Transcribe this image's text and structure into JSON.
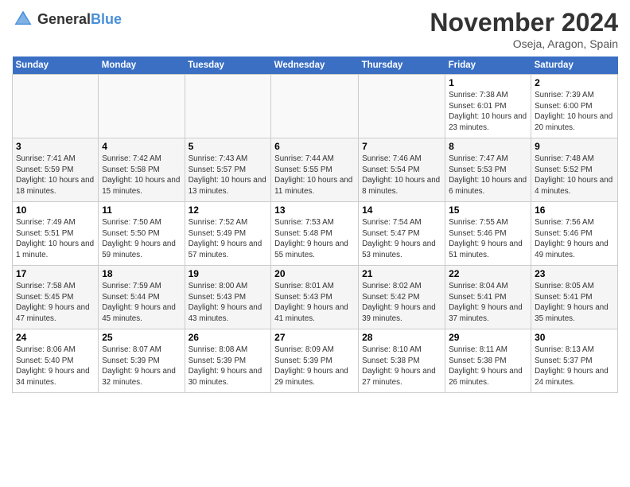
{
  "logo": {
    "general": "General",
    "blue": "Blue"
  },
  "title": "November 2024",
  "subtitle": "Oseja, Aragon, Spain",
  "days_of_week": [
    "Sunday",
    "Monday",
    "Tuesday",
    "Wednesday",
    "Thursday",
    "Friday",
    "Saturday"
  ],
  "weeks": [
    [
      {
        "day": "",
        "info": ""
      },
      {
        "day": "",
        "info": ""
      },
      {
        "day": "",
        "info": ""
      },
      {
        "day": "",
        "info": ""
      },
      {
        "day": "",
        "info": ""
      },
      {
        "day": "1",
        "info": "Sunrise: 7:38 AM\nSunset: 6:01 PM\nDaylight: 10 hours and 23 minutes."
      },
      {
        "day": "2",
        "info": "Sunrise: 7:39 AM\nSunset: 6:00 PM\nDaylight: 10 hours and 20 minutes."
      }
    ],
    [
      {
        "day": "3",
        "info": "Sunrise: 7:41 AM\nSunset: 5:59 PM\nDaylight: 10 hours and 18 minutes."
      },
      {
        "day": "4",
        "info": "Sunrise: 7:42 AM\nSunset: 5:58 PM\nDaylight: 10 hours and 15 minutes."
      },
      {
        "day": "5",
        "info": "Sunrise: 7:43 AM\nSunset: 5:57 PM\nDaylight: 10 hours and 13 minutes."
      },
      {
        "day": "6",
        "info": "Sunrise: 7:44 AM\nSunset: 5:55 PM\nDaylight: 10 hours and 11 minutes."
      },
      {
        "day": "7",
        "info": "Sunrise: 7:46 AM\nSunset: 5:54 PM\nDaylight: 10 hours and 8 minutes."
      },
      {
        "day": "8",
        "info": "Sunrise: 7:47 AM\nSunset: 5:53 PM\nDaylight: 10 hours and 6 minutes."
      },
      {
        "day": "9",
        "info": "Sunrise: 7:48 AM\nSunset: 5:52 PM\nDaylight: 10 hours and 4 minutes."
      }
    ],
    [
      {
        "day": "10",
        "info": "Sunrise: 7:49 AM\nSunset: 5:51 PM\nDaylight: 10 hours and 1 minute."
      },
      {
        "day": "11",
        "info": "Sunrise: 7:50 AM\nSunset: 5:50 PM\nDaylight: 9 hours and 59 minutes."
      },
      {
        "day": "12",
        "info": "Sunrise: 7:52 AM\nSunset: 5:49 PM\nDaylight: 9 hours and 57 minutes."
      },
      {
        "day": "13",
        "info": "Sunrise: 7:53 AM\nSunset: 5:48 PM\nDaylight: 9 hours and 55 minutes."
      },
      {
        "day": "14",
        "info": "Sunrise: 7:54 AM\nSunset: 5:47 PM\nDaylight: 9 hours and 53 minutes."
      },
      {
        "day": "15",
        "info": "Sunrise: 7:55 AM\nSunset: 5:46 PM\nDaylight: 9 hours and 51 minutes."
      },
      {
        "day": "16",
        "info": "Sunrise: 7:56 AM\nSunset: 5:46 PM\nDaylight: 9 hours and 49 minutes."
      }
    ],
    [
      {
        "day": "17",
        "info": "Sunrise: 7:58 AM\nSunset: 5:45 PM\nDaylight: 9 hours and 47 minutes."
      },
      {
        "day": "18",
        "info": "Sunrise: 7:59 AM\nSunset: 5:44 PM\nDaylight: 9 hours and 45 minutes."
      },
      {
        "day": "19",
        "info": "Sunrise: 8:00 AM\nSunset: 5:43 PM\nDaylight: 9 hours and 43 minutes."
      },
      {
        "day": "20",
        "info": "Sunrise: 8:01 AM\nSunset: 5:43 PM\nDaylight: 9 hours and 41 minutes."
      },
      {
        "day": "21",
        "info": "Sunrise: 8:02 AM\nSunset: 5:42 PM\nDaylight: 9 hours and 39 minutes."
      },
      {
        "day": "22",
        "info": "Sunrise: 8:04 AM\nSunset: 5:41 PM\nDaylight: 9 hours and 37 minutes."
      },
      {
        "day": "23",
        "info": "Sunrise: 8:05 AM\nSunset: 5:41 PM\nDaylight: 9 hours and 35 minutes."
      }
    ],
    [
      {
        "day": "24",
        "info": "Sunrise: 8:06 AM\nSunset: 5:40 PM\nDaylight: 9 hours and 34 minutes."
      },
      {
        "day": "25",
        "info": "Sunrise: 8:07 AM\nSunset: 5:39 PM\nDaylight: 9 hours and 32 minutes."
      },
      {
        "day": "26",
        "info": "Sunrise: 8:08 AM\nSunset: 5:39 PM\nDaylight: 9 hours and 30 minutes."
      },
      {
        "day": "27",
        "info": "Sunrise: 8:09 AM\nSunset: 5:39 PM\nDaylight: 9 hours and 29 minutes."
      },
      {
        "day": "28",
        "info": "Sunrise: 8:10 AM\nSunset: 5:38 PM\nDaylight: 9 hours and 27 minutes."
      },
      {
        "day": "29",
        "info": "Sunrise: 8:11 AM\nSunset: 5:38 PM\nDaylight: 9 hours and 26 minutes."
      },
      {
        "day": "30",
        "info": "Sunrise: 8:13 AM\nSunset: 5:37 PM\nDaylight: 9 hours and 24 minutes."
      }
    ]
  ]
}
